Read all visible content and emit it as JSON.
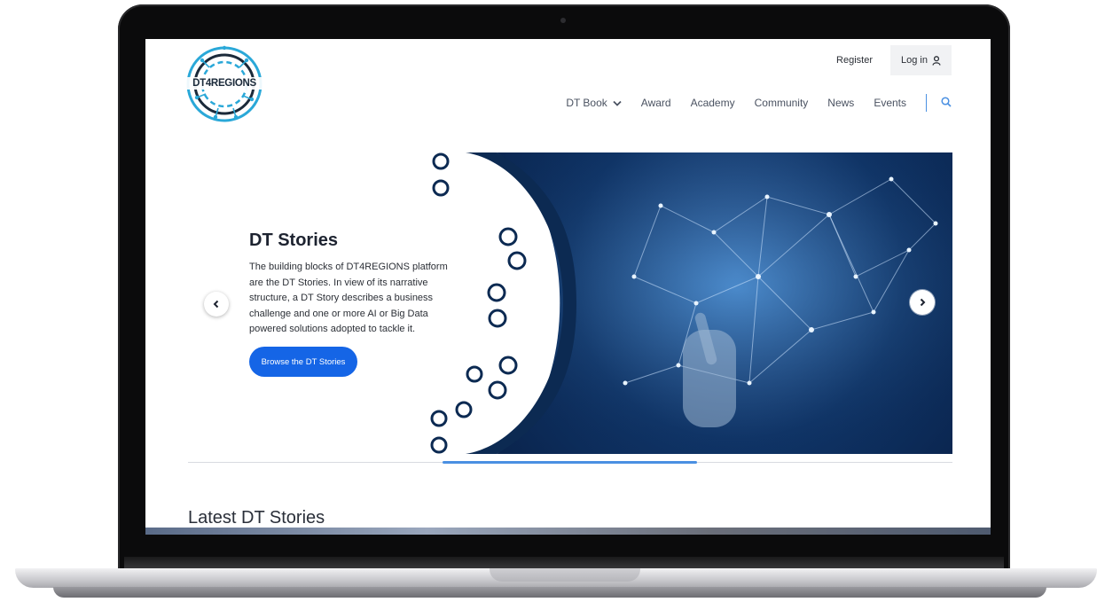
{
  "site": {
    "logo_text": "DT4REGIONS"
  },
  "header": {
    "register_label": "Register",
    "login_label": "Log in"
  },
  "nav": {
    "items": [
      {
        "label": "DT Book"
      },
      {
        "label": "Award"
      },
      {
        "label": "Academy"
      },
      {
        "label": "Community"
      },
      {
        "label": "News"
      },
      {
        "label": "Events"
      }
    ]
  },
  "hero": {
    "title": "DT Stories",
    "description": "The building blocks of DT4REGIONS platform are the DT Stories. In view of its narrative structure, a DT Story describes a business challenge and one or more AI or Big Data powered solutions adopted to tackle it.",
    "button_label": "Browse the DT Stories",
    "carousel_progress": 0.333
  },
  "latest": {
    "title": "Latest DT Stories"
  },
  "colors": {
    "accent": "#1565e6",
    "nav_divider": "#4a90e2",
    "hero_dark": "#0f3467"
  },
  "icons": [
    "user-icon",
    "chevron-down-icon",
    "search-icon",
    "chevron-left-icon",
    "chevron-right-icon"
  ]
}
